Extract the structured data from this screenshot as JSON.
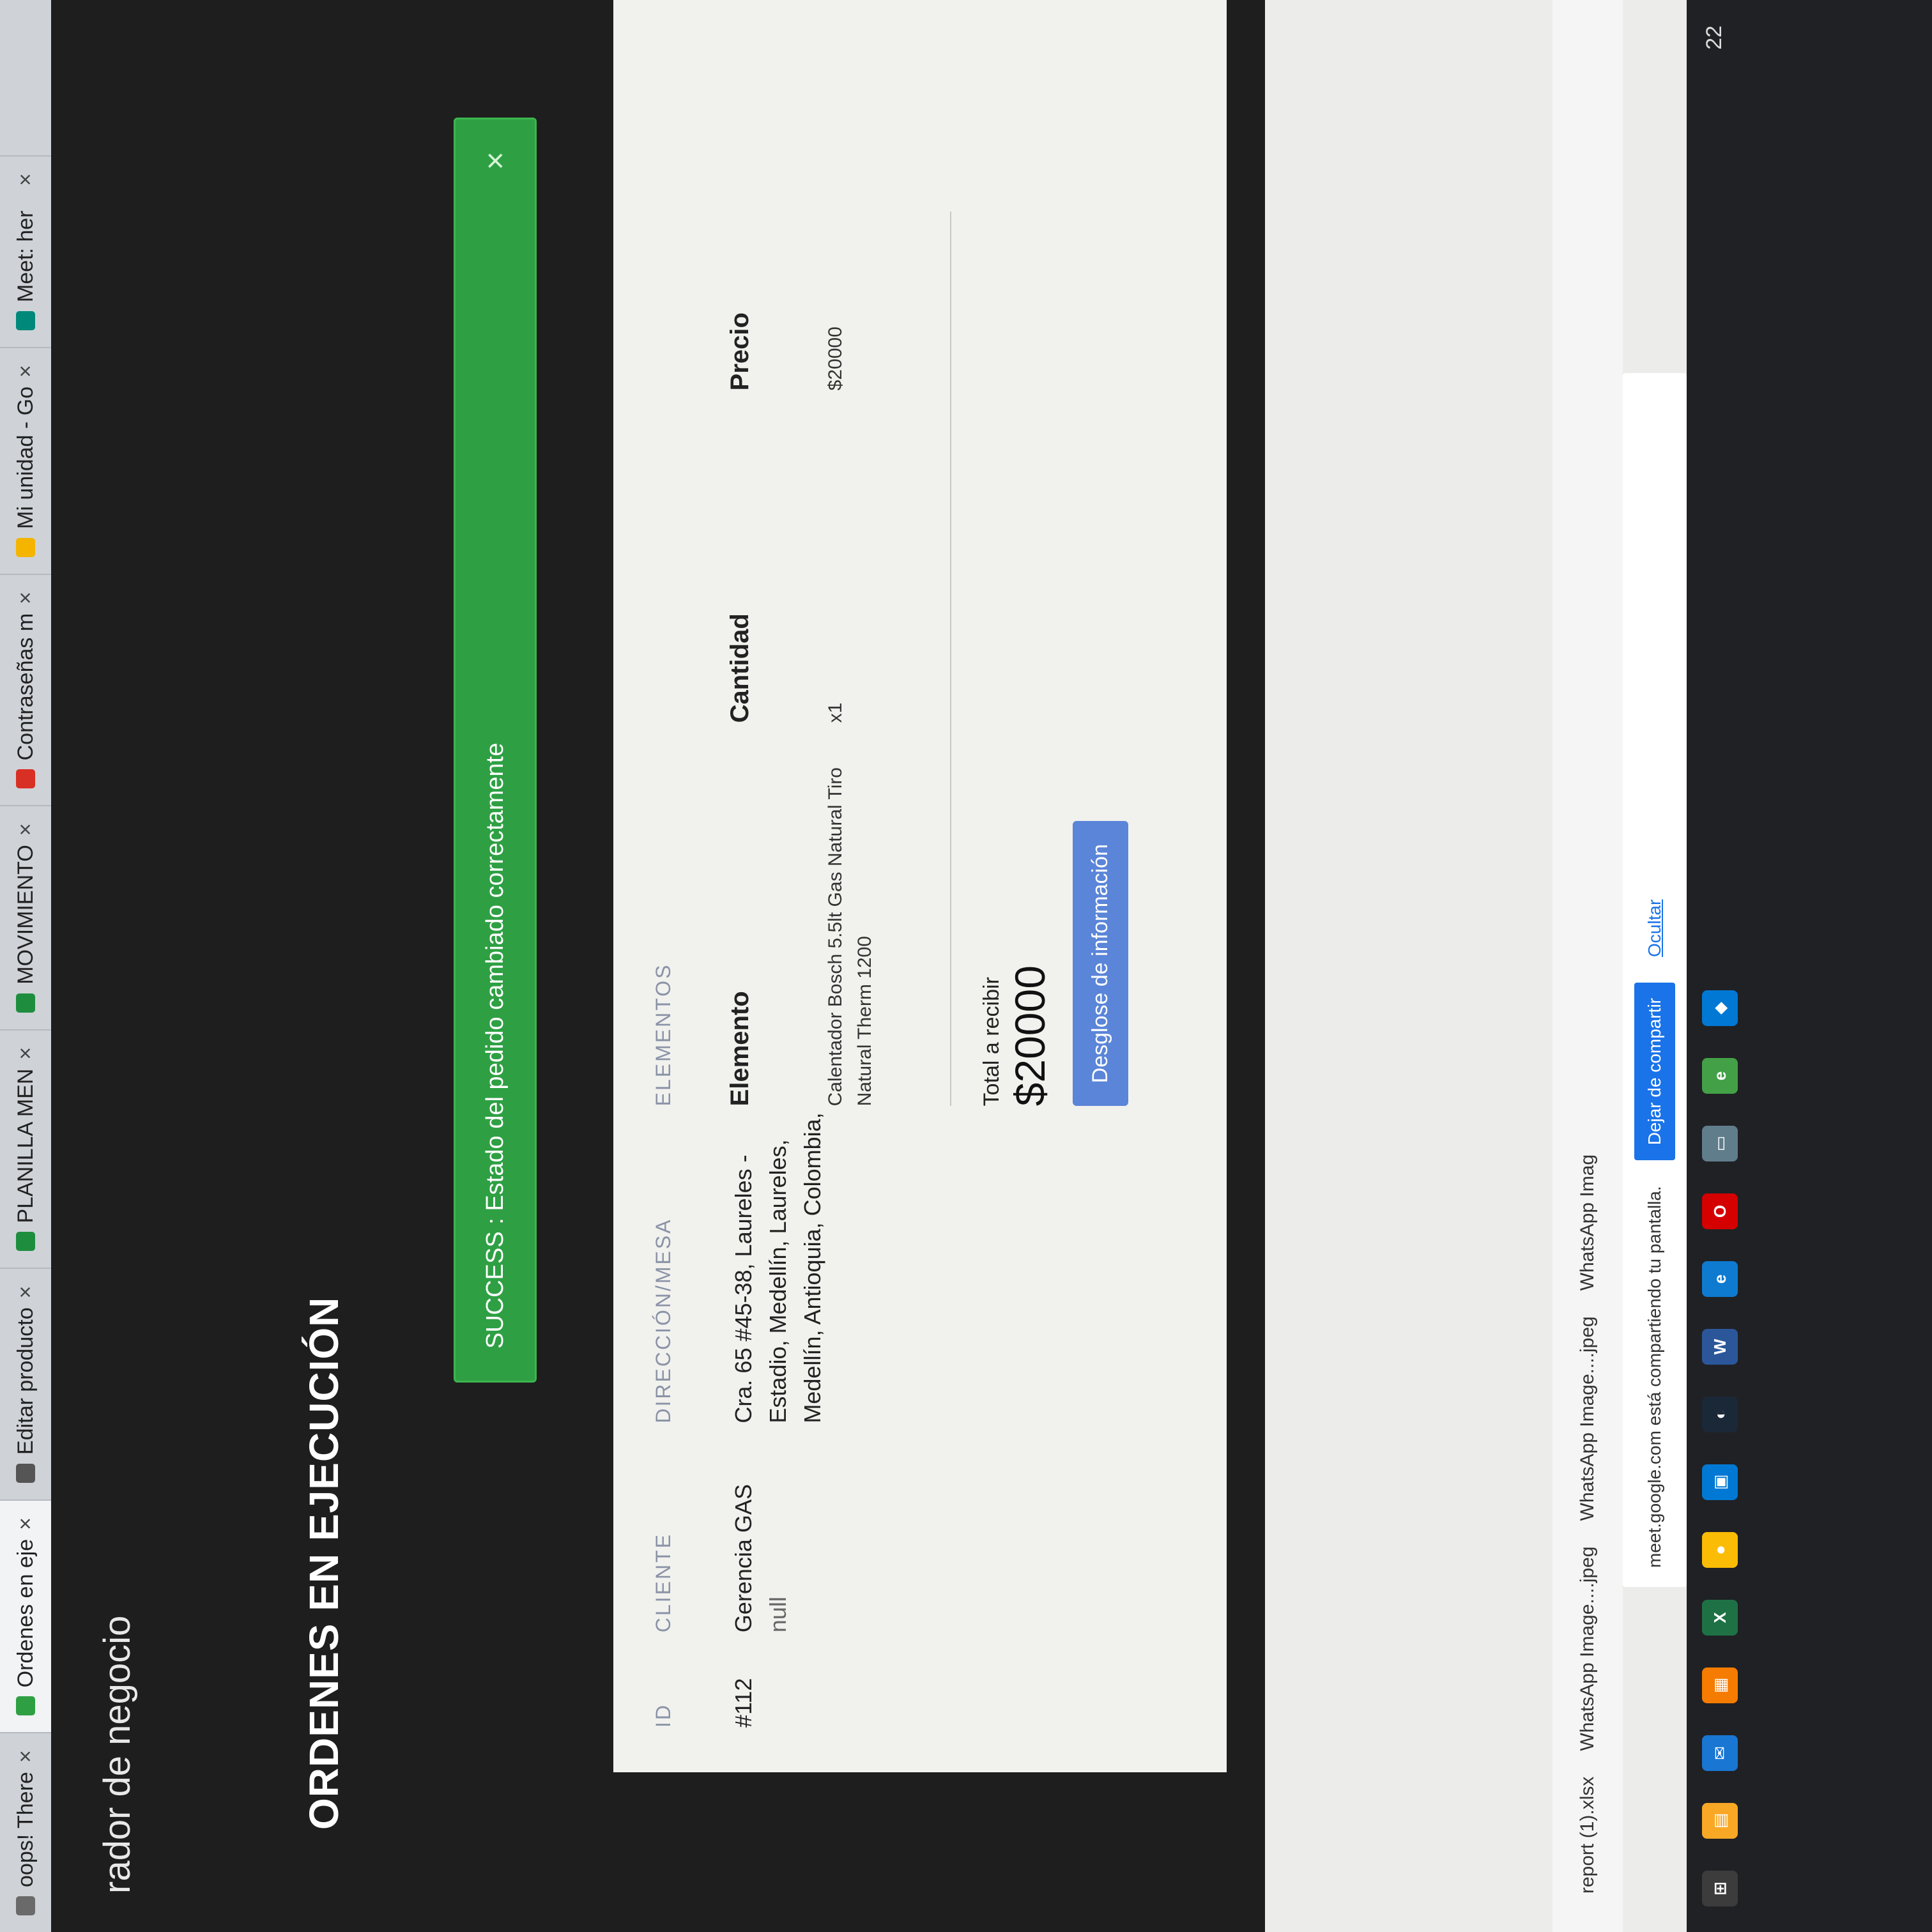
{
  "browser": {
    "tabs": [
      {
        "label": "oops! There",
        "icon": "page-icon",
        "color": "#6a6a6a"
      },
      {
        "label": "Ordenes en eje",
        "icon": "page-icon",
        "color": "#2ea043"
      },
      {
        "label": "Editar producto",
        "icon": "app-icon",
        "color": "#555555"
      },
      {
        "label": "PLANILLA MEN",
        "icon": "sheets-icon",
        "color": "#1e8e3e"
      },
      {
        "label": "MOVIMIENTO",
        "icon": "sheets-icon",
        "color": "#1e8e3e"
      },
      {
        "label": "Contraseñas m",
        "icon": "gmail-icon",
        "color": "#d93025"
      },
      {
        "label": "Mi unidad - Go",
        "icon": "drive-icon",
        "color": "#f4b400"
      },
      {
        "label": "Meet: her",
        "icon": "meet-icon",
        "color": "#00897b"
      }
    ]
  },
  "app": {
    "brand": "rador de negocio",
    "page_title": "ORDENES EN EJECUCIÓN",
    "alert": {
      "text": "SUCCESS : Estado del pedido cambiado correctamente",
      "close": "×"
    },
    "table": {
      "headers": {
        "id": "ID",
        "cliente": "CLIENTE",
        "direccion": "DIRECCIÓN/MESA",
        "elementos": "ELEMENTOS"
      },
      "row": {
        "id": "#112",
        "cliente": "Gerencia GAS",
        "cliente_extra": "null",
        "direccion": "Cra. 65 #45-38, Laureles - Estadio, Medellín, Laureles, Medellín, Antioquia, Colombia,"
      },
      "items_headers": {
        "elemento": "Elemento",
        "cantidad": "Cantidad",
        "precio": "Precio"
      },
      "item": {
        "elemento": "Calentador Bosch 5.5lt Gas Natural Tiro Natural Therm 1200",
        "cantidad": "x1",
        "precio": "$20000"
      },
      "total_label": "Total a recibir",
      "total_value": "$20000",
      "button": "Desglose de información"
    }
  },
  "shelf": {
    "items": [
      "report (1).xlsx",
      "WhatsApp Image....jpeg",
      "WhatsApp Image....jpeg",
      "WhatsApp Imag"
    ]
  },
  "meet": {
    "message": "meet.google.com está compartiendo tu pantalla.",
    "stop": "Dejar de compartir",
    "hide": "Ocultar"
  },
  "taskbar": {
    "icons": [
      {
        "name": "windows-icon",
        "color": "#3c3c3c",
        "glyph": "⊞"
      },
      {
        "name": "explorer-icon",
        "color": "#f9a825",
        "glyph": "▤"
      },
      {
        "name": "mail-icon",
        "color": "#1976d2",
        "glyph": "✉"
      },
      {
        "name": "calendar-icon",
        "color": "#f57c00",
        "glyph": "▦"
      },
      {
        "name": "excel-icon",
        "color": "#1e7145",
        "glyph": "X"
      },
      {
        "name": "chrome-icon",
        "color": "#fbbc05",
        "glyph": "●"
      },
      {
        "name": "store-icon",
        "color": "#0078d4",
        "glyph": "▣"
      },
      {
        "name": "steam-icon",
        "color": "#1b2838",
        "glyph": "◐"
      },
      {
        "name": "word-icon",
        "color": "#2b579a",
        "glyph": "W"
      },
      {
        "name": "edge-icon",
        "color": "#0e7bd1",
        "glyph": "e"
      },
      {
        "name": "opera-icon",
        "color": "#d50000",
        "glyph": "O"
      },
      {
        "name": "photos-icon",
        "color": "#607d8b",
        "glyph": "▭"
      },
      {
        "name": "edge-dev-icon",
        "color": "#43a047",
        "glyph": "e"
      },
      {
        "name": "vscode-icon",
        "color": "#0078d4",
        "glyph": "◆"
      }
    ],
    "clock": "22"
  }
}
